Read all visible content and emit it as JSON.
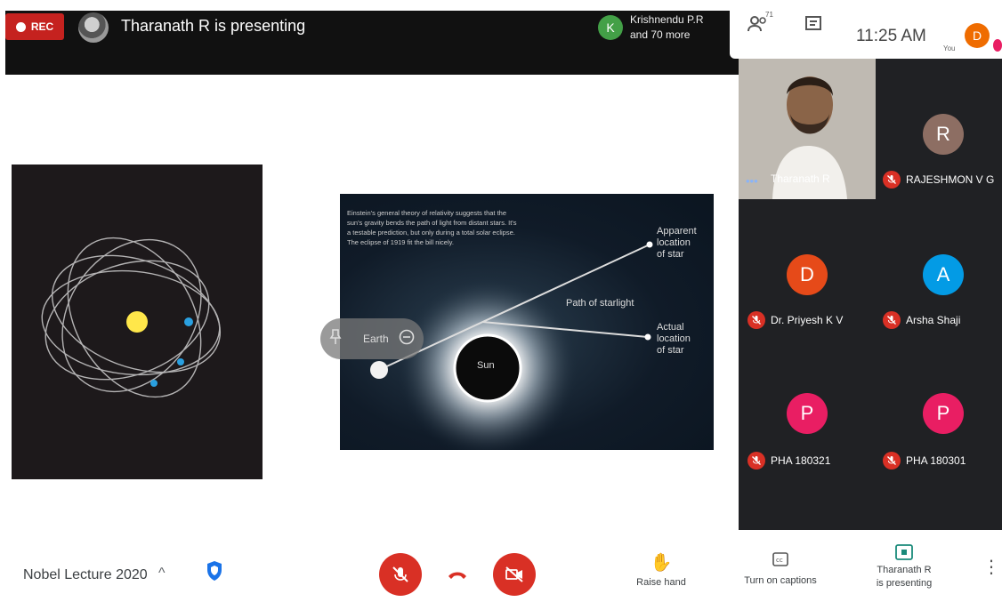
{
  "topbar": {
    "rec_label": "REC",
    "presenting_text": "Tharanath R is presenting",
    "joiner_initial": "K",
    "joiner_line1": "Krishnendu P.R",
    "joiner_line2": "and 70 more"
  },
  "panel_top": {
    "people_count": "71",
    "time": "11:25 AM",
    "you_initial": "D",
    "you_label": "You"
  },
  "slide": {
    "caption": "Einstein's general theory of relativity suggests that the sun's gravity bends the path of light from distant stars. It's a testable prediction, but only during a total solar eclipse. The eclipse of 1919 fit the bill nicely.",
    "apparent_label_1": "Apparent",
    "apparent_label_2": "location",
    "apparent_label_3": "of star",
    "path_label": "Path of starlight",
    "actual_label_1": "Actual",
    "actual_label_2": "location",
    "actual_label_3": "of star",
    "sun_label": "Sun",
    "earth_label": "Earth"
  },
  "participants": {
    "presenter_name": "Tharanath R",
    "tiles": [
      {
        "initial": "R",
        "name": "RAJESHMON V G",
        "color": "#8d6e63"
      },
      {
        "initial": "D",
        "name": "Dr. Priyesh K V",
        "color": "#e64a19"
      },
      {
        "initial": "A",
        "name": "Arsha Shaji",
        "color": "#039be5"
      },
      {
        "initial": "P",
        "name": "PHA 180321",
        "color": "#e91e63"
      },
      {
        "initial": "P",
        "name": "PHA 180301",
        "color": "#e91e63"
      }
    ]
  },
  "bottombar": {
    "meeting_title": "Nobel Lecture 2020",
    "raise_hand": "Raise hand",
    "captions": "Turn on captions",
    "presenting_line1": "Tharanath R",
    "presenting_line2": "is presenting"
  },
  "colors": {
    "danger": "#d93025",
    "accent": "#1a73e8"
  }
}
